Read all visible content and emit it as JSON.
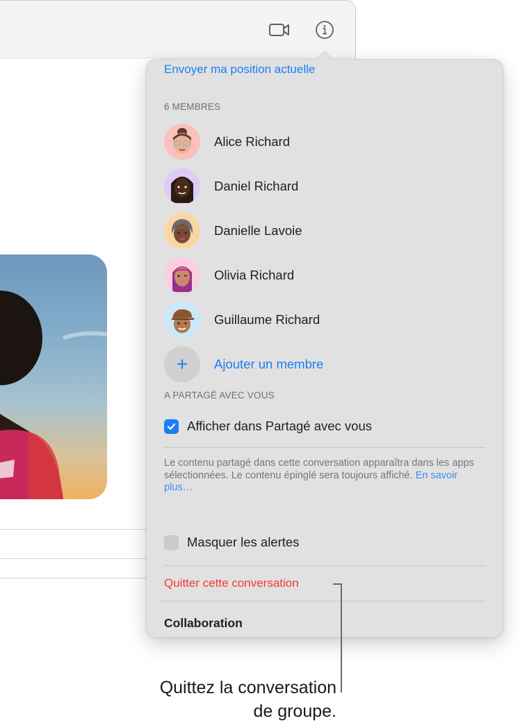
{
  "window": {
    "toolbar": {
      "video_icon": "video-camera-icon",
      "info_icon": "info-circle-icon"
    },
    "photo_description": "Person silhouetted against sunset sky wearing pink top"
  },
  "popover": {
    "send_location_label": "Envoyer ma position actuelle",
    "members_header": "6 MEMBRES",
    "members": [
      {
        "name": "Alice Richard",
        "avatar_bg": "#fbc0bd"
      },
      {
        "name": "Daniel Richard",
        "avatar_bg": "#dccdf7"
      },
      {
        "name": "Danielle Lavoie",
        "avatar_bg": "#fbd6a5"
      },
      {
        "name": "Olivia Richard",
        "avatar_bg": "#fbcfe0"
      },
      {
        "name": "Guillaume Richard",
        "avatar_bg": "#c9e9fb"
      }
    ],
    "add_member": {
      "icon": "plus-icon",
      "label": "Ajouter un membre"
    },
    "shared_header": "A PARTAGÉ AVEC VOUS",
    "show_in_shared": {
      "label": "Afficher dans Partagé avec vous",
      "checked": true
    },
    "description": "Le contenu partagé dans cette conversation apparaîtra dans les apps sélectionnées. Le contenu épinglé sera toujours affiché.",
    "learn_more": "En savoir plus…",
    "hide_alerts": {
      "label": "Masquer les alertes",
      "checked": false
    },
    "leave_label": "Quitter cette conversation",
    "collaboration_header": "Collaboration"
  },
  "callout": {
    "text_line1": "Quittez la conversation",
    "text_line2": "de groupe."
  },
  "colors": {
    "accent": "#1a7ef5",
    "destructive": "#f43b30",
    "popover_bg": "#e1e1e1"
  }
}
